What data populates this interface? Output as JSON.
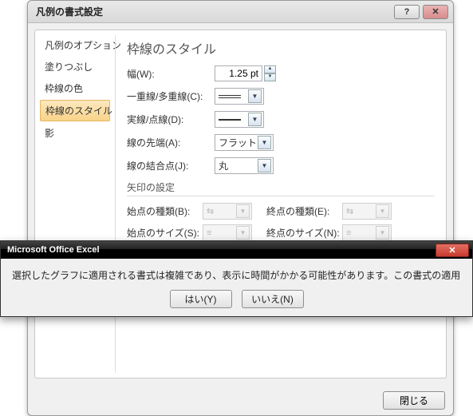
{
  "dialog": {
    "title": "凡例の書式設定",
    "sidebar": {
      "items": [
        {
          "label": "凡例のオプション"
        },
        {
          "label": "塗りつぶし"
        },
        {
          "label": "枠線の色"
        },
        {
          "label": "枠線のスタイル"
        },
        {
          "label": "影"
        }
      ]
    },
    "panel": {
      "heading": "枠線のスタイル",
      "width_label": "幅(W):",
      "width_value": "1.25 pt",
      "compound_label": "一重線/多重線(C):",
      "dash_label": "実線/点線(D):",
      "cap_label": "線の先端(A):",
      "cap_value": "フラット",
      "join_label": "線の結合点(J):",
      "join_value": "丸",
      "arrows_heading": "矢印の設定",
      "begin_type_label": "始点の種類(B):",
      "end_type_label": "終点の種類(E):",
      "begin_size_label": "始点のサイズ(S):",
      "end_size_label": "終点のサイズ(N):"
    },
    "footer": {
      "close": "閉じる"
    }
  },
  "alert": {
    "title": "Microsoft Office Excel",
    "message": "選択したグラフに適用される書式は複雑であり、表示に時間がかかる可能性があります。この書式の適用を続けますか?",
    "yes": "はい(Y)",
    "no": "いいえ(N)"
  }
}
